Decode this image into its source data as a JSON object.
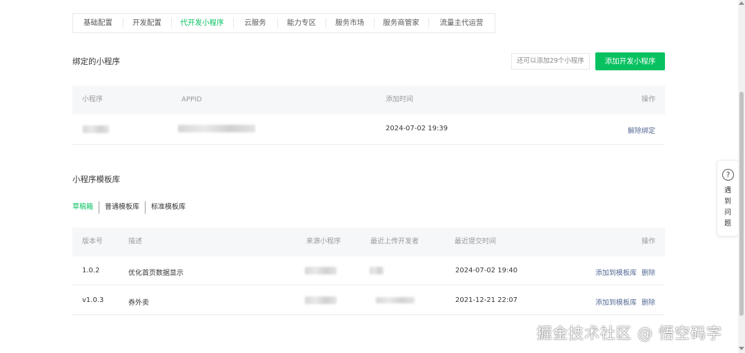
{
  "tabs": [
    {
      "label": "基础配置",
      "active": false
    },
    {
      "label": "开发配置",
      "active": false
    },
    {
      "label": "代开发小程序",
      "active": true
    },
    {
      "label": "云服务",
      "active": false
    },
    {
      "label": "能力专区",
      "active": false
    },
    {
      "label": "服务市场",
      "active": false
    },
    {
      "label": "服务商管家",
      "active": false
    },
    {
      "label": "流量主代运营",
      "active": false
    }
  ],
  "bound": {
    "title": "绑定的小程序",
    "quota_text": "还可以添加29个小程序",
    "add_button": "添加开发小程序",
    "columns": [
      "小程序",
      "APPID",
      "添加时间",
      "操作"
    ],
    "rows": [
      {
        "name": "",
        "appid": "",
        "added_time": "2024-07-02 19:39",
        "action": "解除绑定"
      }
    ]
  },
  "templates": {
    "title": "小程序模板库",
    "subtabs": [
      {
        "label": "草稿箱",
        "active": true
      },
      {
        "label": "普通模板库",
        "active": false
      },
      {
        "label": "标准模板库",
        "active": false
      }
    ],
    "columns": [
      "版本号",
      "描述",
      "来源小程序",
      "最近上传开发者",
      "最近提交时间",
      "操作"
    ],
    "rows": [
      {
        "version": "1.0.2",
        "desc": "优化首页数据显示",
        "submit_time": "2024-07-02 19:40",
        "action_add": "添加到模板库",
        "action_delete": "删除"
      },
      {
        "version": "v1.0.3",
        "desc": "券外卖",
        "submit_time": "2021-12-21 22:07",
        "action_add": "添加到模板库",
        "action_delete": "删除"
      }
    ]
  },
  "help": {
    "icon": "question-circle-icon",
    "icon_glyph": "?",
    "text": "遇到问题"
  },
  "watermark": "掘金技术社区 @ 悟空码字",
  "colors": {
    "accent": "#07c160",
    "link": "#576b95"
  }
}
